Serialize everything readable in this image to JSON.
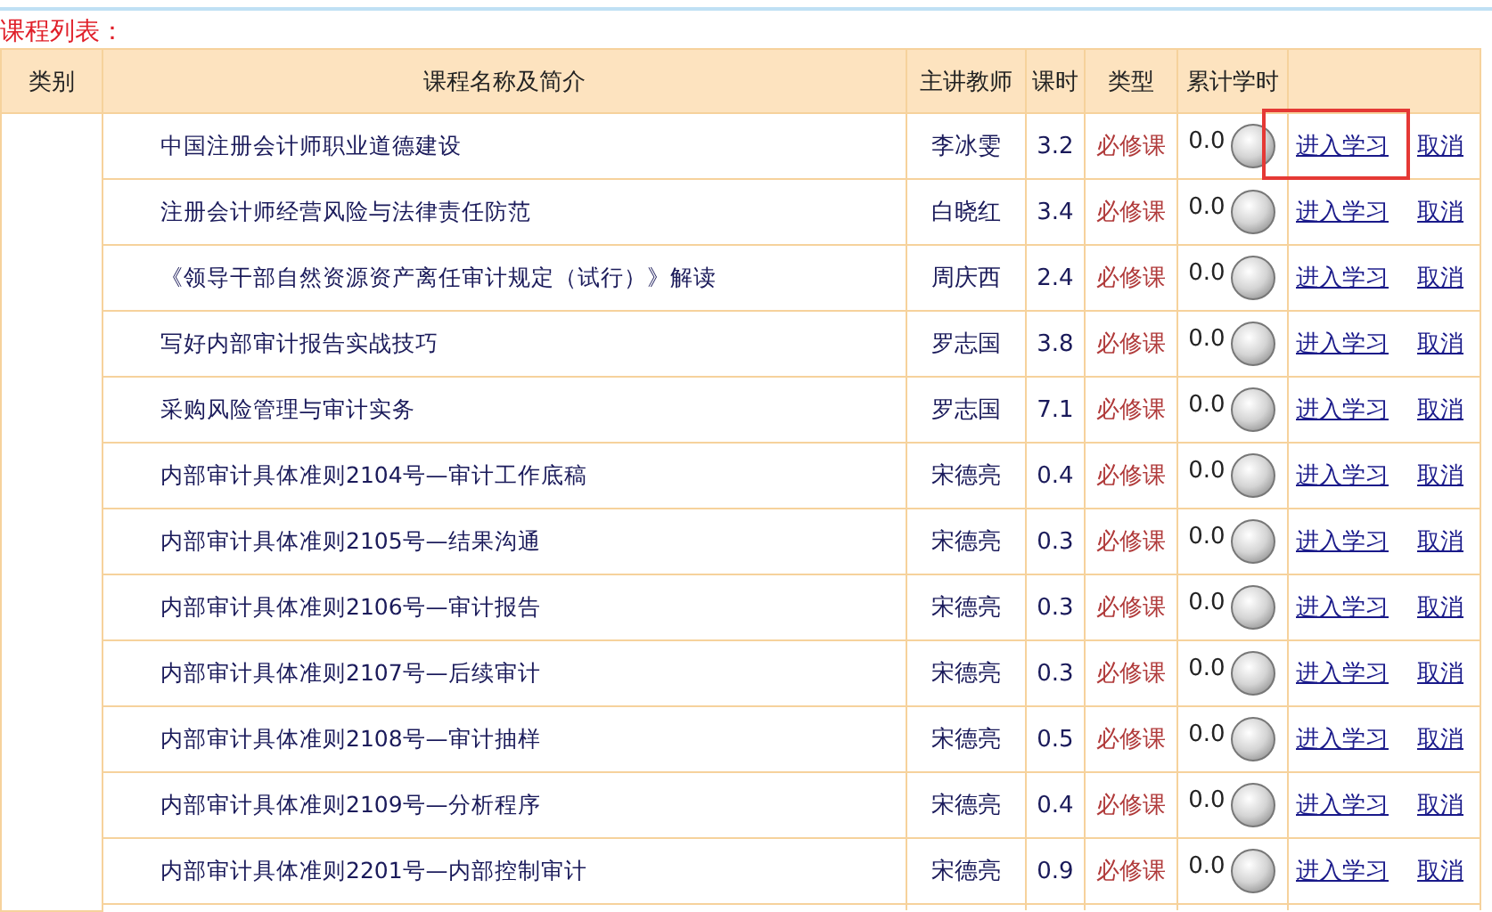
{
  "title": "课程列表：",
  "columns": [
    "类别",
    "课程名称及简介",
    "主讲教师",
    "课时",
    "类型",
    "累计学时"
  ],
  "rows": [
    {
      "name": "中国注册会计师职业道德建设",
      "teacher": "李冰雯",
      "hours": "3.2",
      "type": "必修课",
      "progress": "0.0",
      "enter": "进入学习",
      "cancel": "取消",
      "highlighted": true
    },
    {
      "name": "注册会计师经营风险与法律责任防范",
      "teacher": "白晓红",
      "hours": "3.4",
      "type": "必修课",
      "progress": "0.0",
      "enter": "进入学习",
      "cancel": "取消",
      "highlighted": false
    },
    {
      "name": "《领导干部自然资源资产离任审计规定（试行）》解读",
      "teacher": "周庆西",
      "hours": "2.4",
      "type": "必修课",
      "progress": "0.0",
      "enter": "进入学习",
      "cancel": "取消",
      "highlighted": false
    },
    {
      "name": "写好内部审计报告实战技巧",
      "teacher": "罗志国",
      "hours": "3.8",
      "type": "必修课",
      "progress": "0.0",
      "enter": "进入学习",
      "cancel": "取消",
      "highlighted": false
    },
    {
      "name": "采购风险管理与审计实务",
      "teacher": "罗志国",
      "hours": "7.1",
      "type": "必修课",
      "progress": "0.0",
      "enter": "进入学习",
      "cancel": "取消",
      "highlighted": false
    },
    {
      "name": "内部审计具体准则2104号—审计工作底稿",
      "teacher": "宋德亮",
      "hours": "0.4",
      "type": "必修课",
      "progress": "0.0",
      "enter": "进入学习",
      "cancel": "取消",
      "highlighted": false
    },
    {
      "name": "内部审计具体准则2105号—结果沟通",
      "teacher": "宋德亮",
      "hours": "0.3",
      "type": "必修课",
      "progress": "0.0",
      "enter": "进入学习",
      "cancel": "取消",
      "highlighted": false
    },
    {
      "name": "内部审计具体准则2106号—审计报告",
      "teacher": "宋德亮",
      "hours": "0.3",
      "type": "必修课",
      "progress": "0.0",
      "enter": "进入学习",
      "cancel": "取消",
      "highlighted": false
    },
    {
      "name": "内部审计具体准则2107号—后续审计",
      "teacher": "宋德亮",
      "hours": "0.3",
      "type": "必修课",
      "progress": "0.0",
      "enter": "进入学习",
      "cancel": "取消",
      "highlighted": false
    },
    {
      "name": "内部审计具体准则2108号—审计抽样",
      "teacher": "宋德亮",
      "hours": "0.5",
      "type": "必修课",
      "progress": "0.0",
      "enter": "进入学习",
      "cancel": "取消",
      "highlighted": false
    },
    {
      "name": "内部审计具体准则2109号—分析程序",
      "teacher": "宋德亮",
      "hours": "0.4",
      "type": "必修课",
      "progress": "0.0",
      "enter": "进入学习",
      "cancel": "取消",
      "highlighted": false
    },
    {
      "name": "内部审计具体准则2201号—内部控制审计",
      "teacher": "宋德亮",
      "hours": "0.9",
      "type": "必修课",
      "progress": "0.0",
      "enter": "进入学习",
      "cancel": "取消",
      "highlighted": false
    }
  ]
}
